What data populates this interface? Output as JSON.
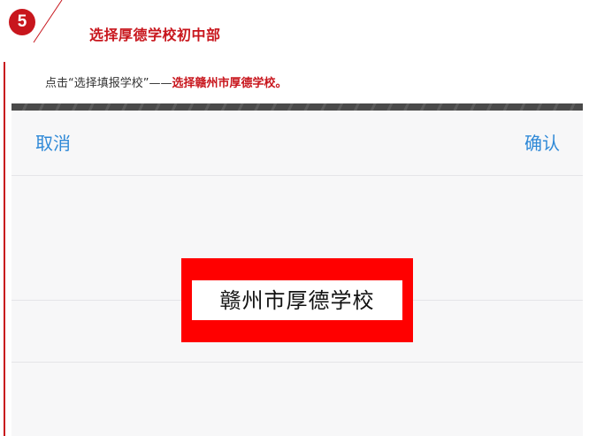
{
  "step": {
    "number": "5",
    "title": "选择厚德学校初中部"
  },
  "instruction": {
    "prefix": "点击“选择填报学校”——",
    "highlight": "选择赣州市厚德学校。"
  },
  "picker": {
    "cancel_label": "取消",
    "confirm_label": "确认",
    "selected_option": "赣州市厚德学校"
  },
  "colors": {
    "accent_red": "#c8161d",
    "highlight_box": "#ff0000",
    "ios_blue": "#2f89d7"
  }
}
